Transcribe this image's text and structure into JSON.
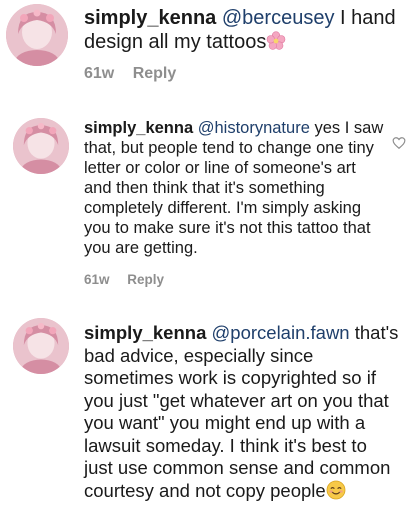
{
  "comments": [
    {
      "username": "simply_kenna",
      "mention": "@berceusey",
      "body": " I hand design all my tattoos",
      "emoji": "cherry-blossom",
      "time": "61w",
      "reply_label": "Reply"
    },
    {
      "username": "simply_kenna",
      "mention": "@historynature",
      "body": " yes I saw that, but people tend to change one tiny letter or color or line of someone's art and then think that it's something completely different. I'm simply asking you to make sure it's not this tattoo that you are getting.",
      "time": "61w",
      "reply_label": "Reply"
    },
    {
      "username": "simply_kenna",
      "mention": "@porcelain.fawn",
      "body": " that's bad advice, especially since sometimes work is copyrighted so if you just \"get whatever art on you that you want\" you might end up with a lawsuit someday. I think it's best to just use common sense and common courtesy and not copy people",
      "emoji": "smiling-face-with-smiling-eyes"
    }
  ],
  "colors": {
    "text": "#1a1a1a",
    "mention": "#1f3f6b",
    "meta": "#8e8e8e"
  }
}
